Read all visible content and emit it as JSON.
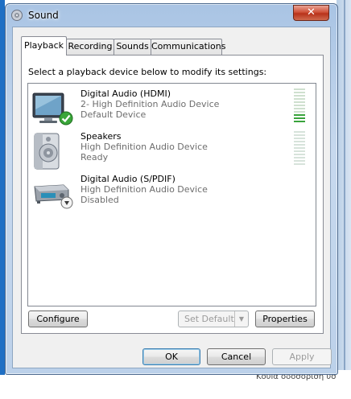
{
  "window": {
    "title": "Sound",
    "close_label": "✕"
  },
  "tabs": [
    {
      "label": "Playback"
    },
    {
      "label": "Recording"
    },
    {
      "label": "Sounds"
    },
    {
      "label": "Communications"
    }
  ],
  "playback": {
    "instruction": "Select a playback device below to modify its settings:",
    "devices": [
      {
        "name": "Digital Audio (HDMI)",
        "description": "2- High Definition Audio Device",
        "status": "Default Device",
        "icon": "monitor-icon",
        "badge": "default-check-icon"
      },
      {
        "name": "Speakers",
        "description": "High Definition Audio Device",
        "status": "Ready",
        "icon": "speaker-icon"
      },
      {
        "name": "Digital Audio (S/PDIF)",
        "description": "High Definition Audio Device",
        "status": "Disabled",
        "icon": "receiver-icon",
        "badge": "disabled-arrow-icon"
      }
    ]
  },
  "panel_buttons": {
    "configure": "Configure",
    "set_default": "Set Default",
    "properties": "Properties"
  },
  "dialog_buttons": {
    "ok": "OK",
    "cancel": "Cancel",
    "apply": "Apply"
  },
  "background": {
    "partial_text": "Κουiα οδοσοριση υσ"
  }
}
